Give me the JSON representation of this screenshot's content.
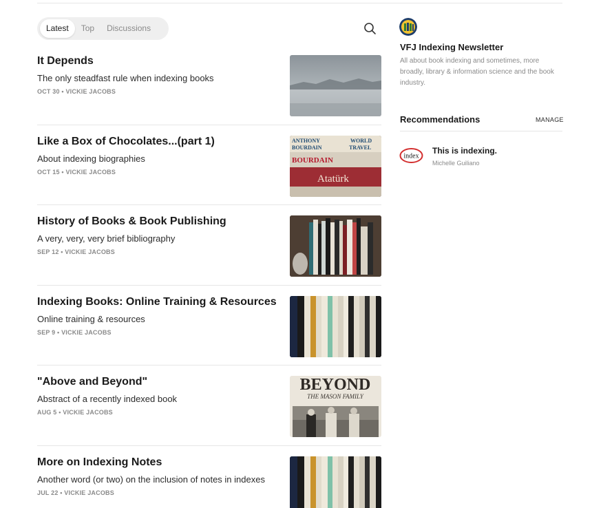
{
  "tabs": [
    "Latest",
    "Top",
    "Discussions"
  ],
  "active_tab": "Latest",
  "posts": [
    {
      "title": "It Depends",
      "subtitle": "The only steadfast rule when indexing books",
      "meta": "OCT 30 • VICKIE JACOBS"
    },
    {
      "title": "Like a Box of Chocolates...(part 1)",
      "subtitle": "About indexing biographies",
      "meta": "OCT 15 • VICKIE JACOBS"
    },
    {
      "title": "History of Books & Book Publishing",
      "subtitle": "A very, very, very brief bibliography",
      "meta": "SEP 12 • VICKIE JACOBS"
    },
    {
      "title": "Indexing Books: Online Training & Resources",
      "subtitle": "Online training & resources",
      "meta": "SEP 9 • VICKIE JACOBS"
    },
    {
      "title": "\"Above and Beyond\"",
      "subtitle": "Abstract of a recently indexed book",
      "meta": "AUG 5 • VICKIE JACOBS"
    },
    {
      "title": "More on Indexing Notes",
      "subtitle": "Another word (or two) on the inclusion of notes in indexes",
      "meta": "JUL 22 • VICKIE JACOBS"
    }
  ],
  "thumb_text": {
    "book1_a": "ANTHONY",
    "book1_b": "BOURDAIN",
    "book1_c": "WORLD",
    "book1_d": "TRAVEL",
    "book2": "BOURDAIN",
    "book3": "Atatürk",
    "beyond_headline": "BEYOND",
    "beyond_sub": "THE MASON FAMILY"
  },
  "newsletter": {
    "name": "VFJ Indexing Newsletter",
    "description": "All about book indexing and sometimes, more broadly, library & information science and the book industry."
  },
  "recommendations": {
    "heading": "Recommendations",
    "manage_label": "MANAGE",
    "items": [
      {
        "title": "This is indexing.",
        "author": "Michelle Guiliano",
        "logo_text": "index"
      }
    ]
  },
  "icons": {
    "search": "search-icon"
  },
  "colors": {
    "tab_bg": "#efefef",
    "meta": "#8a8a8a",
    "divider": "#e6e6e6",
    "rec_logo_red": "#d32f2f"
  }
}
